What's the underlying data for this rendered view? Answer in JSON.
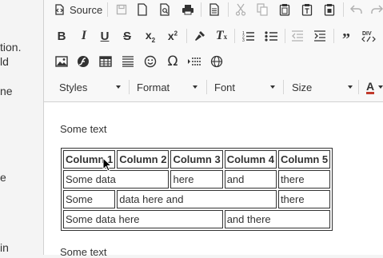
{
  "left_page": {
    "fragments": [
      "tion.",
      "ld",
      "ne",
      "e",
      "in"
    ]
  },
  "toolbar": {
    "source_label": "Source",
    "styles_label": "Styles",
    "format_label": "Format",
    "font_label": "Font",
    "size_label": "Size",
    "text_color_label": "A",
    "row1_icons": [
      "source-icon",
      "save-icon",
      "new-page-icon",
      "preview-icon",
      "print-icon",
      "templates-icon",
      "cut-icon",
      "copy-icon",
      "paste-icon",
      "paste-text-icon",
      "paste-word-icon",
      "undo-icon",
      "redo-icon"
    ],
    "row2_icons": [
      "bold-icon",
      "italic-icon",
      "underline-icon",
      "strikethrough-icon",
      "subscript-icon",
      "superscript-icon",
      "copy-format-icon",
      "remove-format-icon",
      "numbered-list-icon",
      "bulleted-list-icon",
      "decrease-indent-icon",
      "increase-indent-icon",
      "blockquote-icon",
      "div-icon"
    ],
    "row3_icons": [
      "image-icon",
      "flash-icon",
      "table-icon",
      "horizontal-line-icon",
      "smiley-icon",
      "special-char-icon",
      "page-break-icon",
      "iframe-icon"
    ],
    "colors": {
      "icon": "#333333",
      "disabled": "#b0b0b0",
      "toolbar_bg": "#f8f8f8",
      "text_color_bar": "#c0392b"
    }
  },
  "content": {
    "para_top": "Some text",
    "para_bottom": "Some text",
    "table": {
      "header": [
        "Column 1",
        "Column 2",
        "Column 3",
        "Column 4",
        "Column 5"
      ],
      "row1": [
        "Some data",
        "here",
        "and",
        "there"
      ],
      "row2": [
        "Some",
        "data here and",
        "there"
      ],
      "row3": [
        "Some data here",
        "and there"
      ]
    }
  }
}
